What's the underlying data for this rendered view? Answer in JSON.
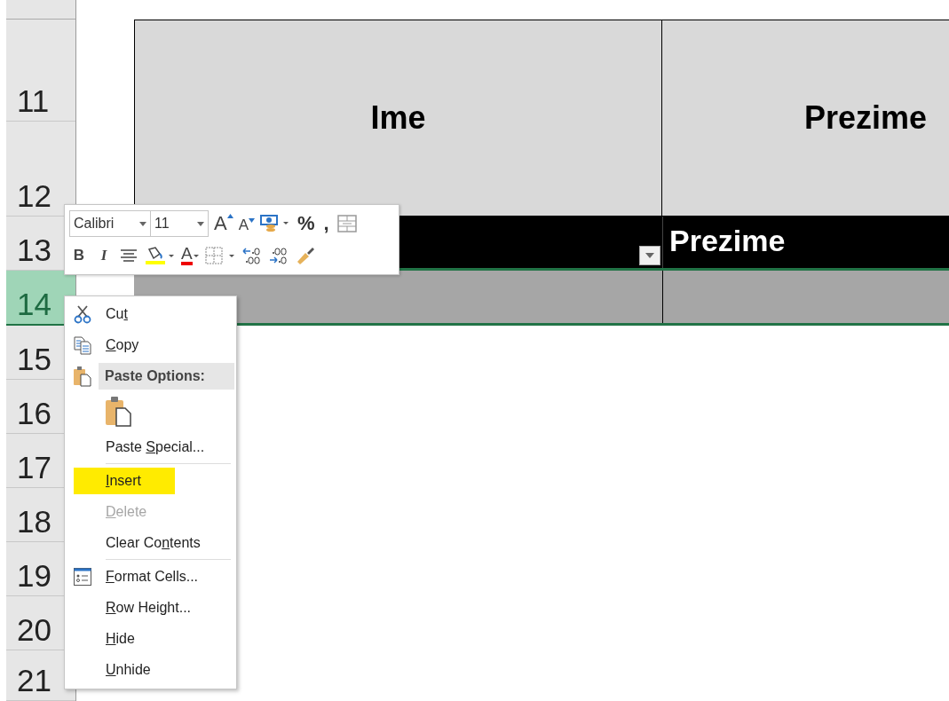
{
  "row_headers": [
    {
      "label": "11",
      "selected": false
    },
    {
      "label": "12",
      "selected": false
    },
    {
      "label": "13",
      "selected": false
    },
    {
      "label": "14",
      "selected": true
    },
    {
      "label": "15",
      "selected": false
    },
    {
      "label": "16",
      "selected": false
    },
    {
      "label": "17",
      "selected": false
    },
    {
      "label": "18",
      "selected": false
    },
    {
      "label": "19",
      "selected": false
    },
    {
      "label": "20",
      "selected": false
    },
    {
      "label": "21",
      "selected": false
    }
  ],
  "table": {
    "headers": [
      "Ime",
      "Prezime"
    ],
    "filter_row": {
      "label": "Prezime"
    }
  },
  "mini_toolbar": {
    "font": "Calibri",
    "size": "11",
    "grow": "A",
    "shrink": "A",
    "percent": "%",
    "comma": ",",
    "bold": "B",
    "italic": "I",
    "font_color": "A"
  },
  "context_menu": [
    {
      "kind": "item",
      "label": "Cut",
      "disabled": false,
      "highlighted": false
    },
    {
      "kind": "item",
      "label": "Copy",
      "disabled": false,
      "highlighted": false
    },
    {
      "kind": "header",
      "label": "Paste Options:"
    },
    {
      "kind": "paste"
    },
    {
      "kind": "item",
      "label": "Paste Special...",
      "disabled": false,
      "highlighted": false
    },
    {
      "kind": "separator"
    },
    {
      "kind": "item",
      "label": "Insert",
      "disabled": false,
      "highlighted": true
    },
    {
      "kind": "item",
      "label": "Delete",
      "disabled": true,
      "highlighted": false
    },
    {
      "kind": "item",
      "label": "Clear Contents",
      "disabled": false,
      "highlighted": false
    },
    {
      "kind": "separator"
    },
    {
      "kind": "item",
      "label": "Format Cells...",
      "disabled": false,
      "highlighted": false
    },
    {
      "kind": "item",
      "label": "Row Height...",
      "disabled": false,
      "highlighted": false
    },
    {
      "kind": "item",
      "label": "Hide",
      "disabled": false,
      "highlighted": false
    },
    {
      "kind": "item",
      "label": "Unhide",
      "disabled": false,
      "highlighted": false
    }
  ]
}
